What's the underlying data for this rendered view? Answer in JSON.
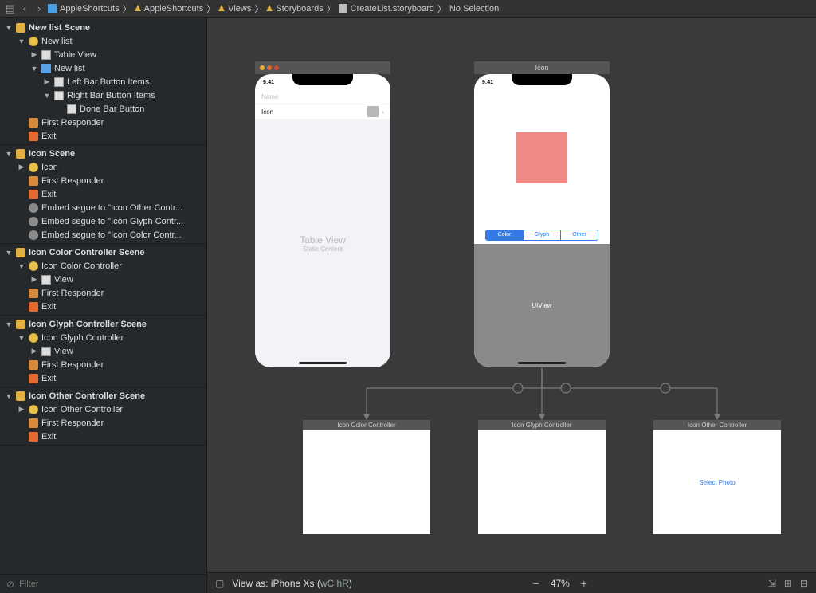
{
  "breadcrumb": {
    "items": [
      "AppleShortcuts",
      "AppleShortcuts",
      "Views",
      "Storyboards",
      "CreateList.storyboard",
      "No Selection"
    ]
  },
  "outline": {
    "scenes": [
      {
        "name": "New list Scene",
        "rows": [
          {
            "ind": 1,
            "disc": "▼",
            "icon": "ic-vc",
            "label": "New list"
          },
          {
            "ind": 2,
            "disc": "▶",
            "icon": "ic-view",
            "label": "Table View"
          },
          {
            "ind": 2,
            "disc": "▼",
            "icon": "ic-nav",
            "label": "New list"
          },
          {
            "ind": 3,
            "disc": "▶",
            "icon": "ic-view",
            "label": "Left Bar Button Items"
          },
          {
            "ind": 3,
            "disc": "▼",
            "icon": "ic-view",
            "label": "Right Bar Button Items"
          },
          {
            "ind": 4,
            "disc": "",
            "icon": "ic-view",
            "label": "Done Bar Button"
          },
          {
            "ind": 1,
            "disc": "",
            "icon": "ic-fr",
            "label": "First Responder"
          },
          {
            "ind": 1,
            "disc": "",
            "icon": "ic-exit",
            "label": "Exit"
          }
        ]
      },
      {
        "name": "Icon Scene",
        "rows": [
          {
            "ind": 1,
            "disc": "▶",
            "icon": "ic-vc",
            "label": "Icon"
          },
          {
            "ind": 1,
            "disc": "",
            "icon": "ic-fr",
            "label": "First Responder"
          },
          {
            "ind": 1,
            "disc": "",
            "icon": "ic-exit",
            "label": "Exit"
          },
          {
            "ind": 1,
            "disc": "",
            "icon": "ic-segue",
            "label": "Embed segue to \"Icon Other Contr..."
          },
          {
            "ind": 1,
            "disc": "",
            "icon": "ic-segue",
            "label": "Embed segue to \"Icon Glyph Contr..."
          },
          {
            "ind": 1,
            "disc": "",
            "icon": "ic-segue",
            "label": "Embed segue to \"Icon Color Contr..."
          }
        ]
      },
      {
        "name": "Icon Color Controller Scene",
        "rows": [
          {
            "ind": 1,
            "disc": "▼",
            "icon": "ic-vc",
            "label": "Icon Color Controller"
          },
          {
            "ind": 2,
            "disc": "▶",
            "icon": "ic-view",
            "label": "View"
          },
          {
            "ind": 1,
            "disc": "",
            "icon": "ic-fr",
            "label": "First Responder"
          },
          {
            "ind": 1,
            "disc": "",
            "icon": "ic-exit",
            "label": "Exit"
          }
        ]
      },
      {
        "name": "Icon Glyph Controller Scene",
        "rows": [
          {
            "ind": 1,
            "disc": "▼",
            "icon": "ic-vc",
            "label": "Icon Glyph Controller"
          },
          {
            "ind": 2,
            "disc": "▶",
            "icon": "ic-view",
            "label": "View"
          },
          {
            "ind": 1,
            "disc": "",
            "icon": "ic-fr",
            "label": "First Responder"
          },
          {
            "ind": 1,
            "disc": "",
            "icon": "ic-exit",
            "label": "Exit"
          }
        ]
      },
      {
        "name": "Icon Other Controller Scene",
        "rows": [
          {
            "ind": 1,
            "disc": "▶",
            "icon": "ic-vc",
            "label": "Icon Other Controller"
          },
          {
            "ind": 1,
            "disc": "",
            "icon": "ic-fr",
            "label": "First Responder"
          },
          {
            "ind": 1,
            "disc": "",
            "icon": "ic-exit",
            "label": "Exit"
          }
        ]
      }
    ],
    "filter_placeholder": "Filter"
  },
  "canvas": {
    "left_scene": {
      "title": "",
      "time": "9:41",
      "field_placeholder": "Name",
      "cell_label": "Icon",
      "ghost_title": "Table View",
      "ghost_sub": "Static Content"
    },
    "right_scene": {
      "title": "Icon",
      "time": "9:41",
      "seg": [
        "Color",
        "Glyph",
        "Other"
      ],
      "container_label": "UIView"
    },
    "children": [
      {
        "title": "Icon Color Controller",
        "body": ""
      },
      {
        "title": "Icon Glyph Controller",
        "body": ""
      },
      {
        "title": "Icon Other Controller",
        "body": "Select Photo"
      }
    ]
  },
  "bottom": {
    "view_as": "View as: iPhone Xs (",
    "size_class": "wC hR",
    "close": ")",
    "zoom": "47%"
  }
}
